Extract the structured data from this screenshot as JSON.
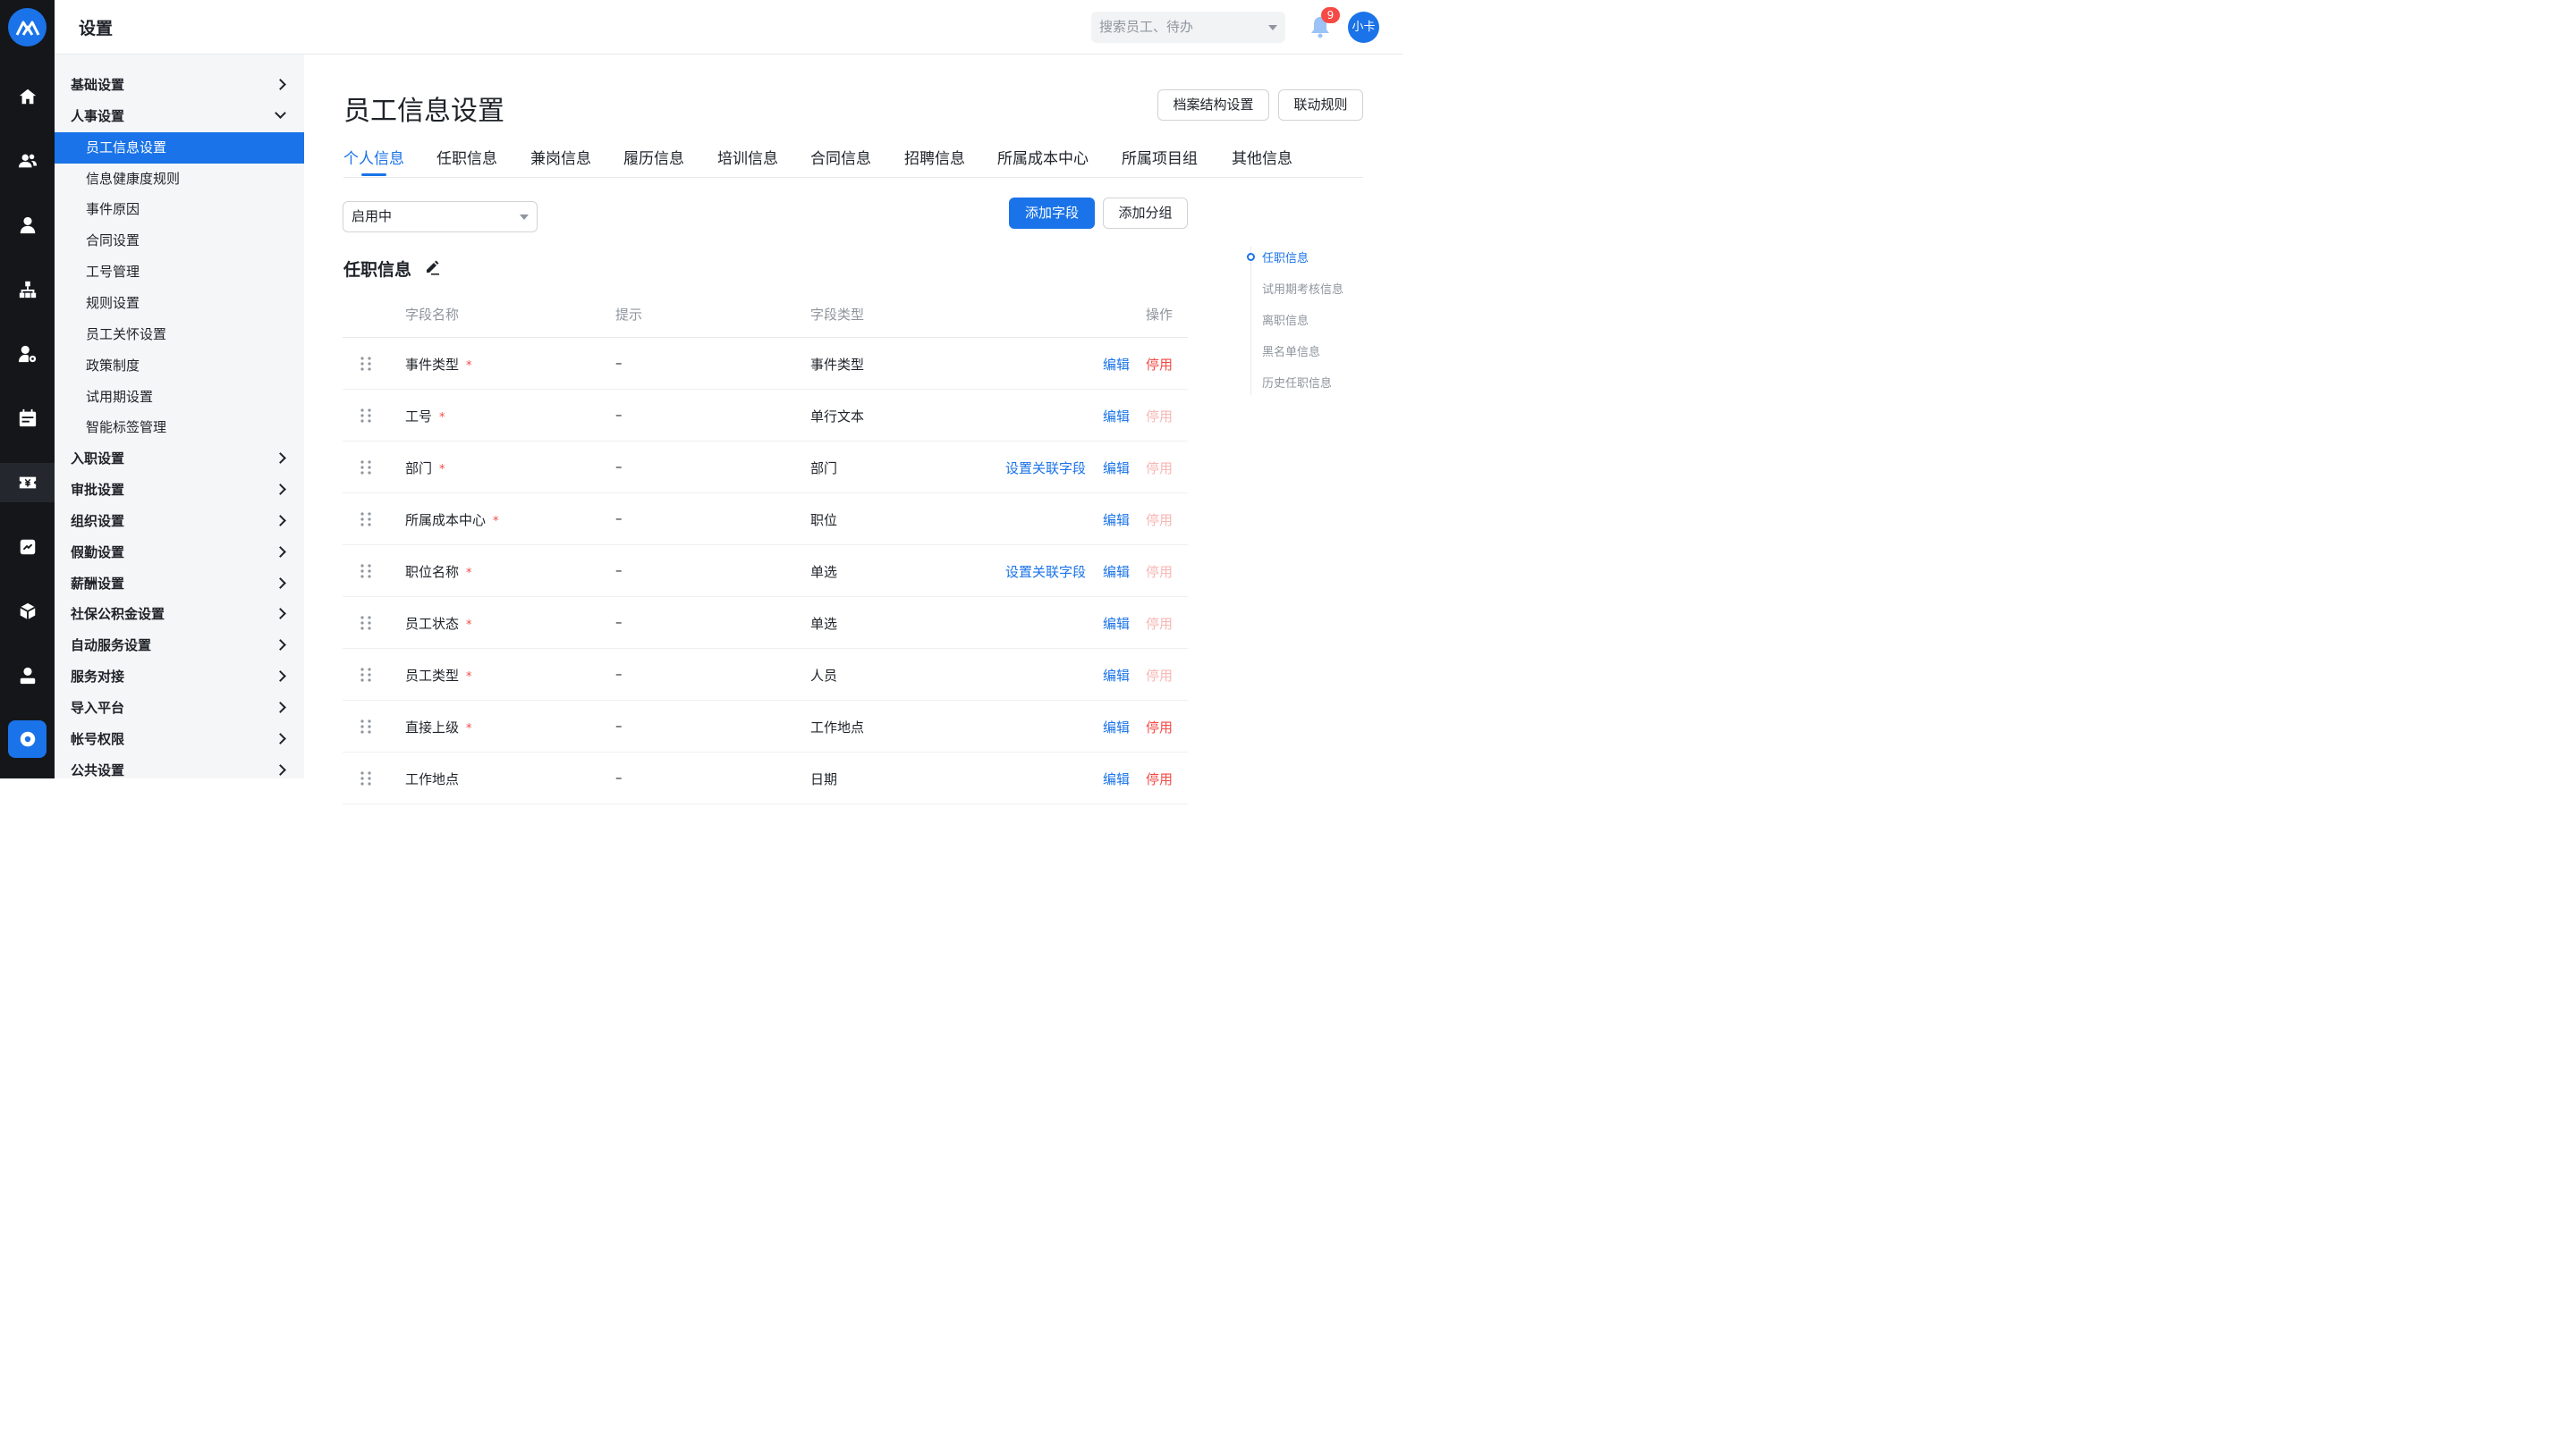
{
  "header": {
    "title": "设置",
    "search_placeholder": "搜索员工、待办",
    "notification_count": "9",
    "avatar_label": "小卡"
  },
  "rail": {
    "icons": [
      "home-icon",
      "people-icon",
      "person-icon",
      "org-chart-icon",
      "person-settings-icon",
      "calendar-icon",
      "payroll-icon",
      "report-icon",
      "box-icon",
      "user-icon",
      "settings-icon"
    ]
  },
  "sidebar": {
    "items": [
      {
        "label": "基础设置",
        "level": "top",
        "chevron": "right"
      },
      {
        "label": "人事设置",
        "level": "top",
        "chevron": "down"
      },
      {
        "label": "员工信息设置",
        "level": "sub",
        "active": true
      },
      {
        "label": "信息健康度规则",
        "level": "sub"
      },
      {
        "label": "事件原因",
        "level": "sub"
      },
      {
        "label": "合同设置",
        "level": "sub"
      },
      {
        "label": "工号管理",
        "level": "sub"
      },
      {
        "label": "规则设置",
        "level": "sub"
      },
      {
        "label": "员工关怀设置",
        "level": "sub"
      },
      {
        "label": "政策制度",
        "level": "sub"
      },
      {
        "label": "试用期设置",
        "level": "sub"
      },
      {
        "label": "智能标签管理",
        "level": "sub"
      },
      {
        "label": "入职设置",
        "level": "top",
        "chevron": "right"
      },
      {
        "label": "审批设置",
        "level": "top",
        "chevron": "right"
      },
      {
        "label": "组织设置",
        "level": "top",
        "chevron": "right"
      },
      {
        "label": "假勤设置",
        "level": "top",
        "chevron": "right"
      },
      {
        "label": "薪酬设置",
        "level": "top",
        "chevron": "right"
      },
      {
        "label": "社保公积金设置",
        "level": "top",
        "chevron": "right"
      },
      {
        "label": "自动服务设置",
        "level": "top",
        "chevron": "right"
      },
      {
        "label": "服务对接",
        "level": "top",
        "chevron": "right"
      },
      {
        "label": "导入平台",
        "level": "top",
        "chevron": "right"
      },
      {
        "label": "帐号权限",
        "level": "top",
        "chevron": "right"
      },
      {
        "label": "公共设置",
        "level": "top",
        "chevron": "right"
      }
    ]
  },
  "main": {
    "title": "员工信息设置",
    "btn_archive": "档案结构设置",
    "btn_linkage": "联动规则",
    "tabs": [
      "个人信息",
      "任职信息",
      "兼岗信息",
      "履历信息",
      "培训信息",
      "合同信息",
      "招聘信息",
      "所属成本中心",
      "所属项目组",
      "其他信息"
    ],
    "status_select": "启用中",
    "btn_add_field": "添加字段",
    "btn_add_group": "添加分组",
    "section_title": "任职信息",
    "columns": {
      "name": "字段名称",
      "hint": "提示",
      "type": "字段类型",
      "ops": "操作"
    },
    "rows": [
      {
        "name": "事件类型",
        "required": "*",
        "hint": "–",
        "type": "事件类型",
        "link": "",
        "edit": "编辑",
        "disable": "停用",
        "disable_enabled": true
      },
      {
        "name": "工号",
        "required": "*",
        "hint": "–",
        "type": "单行文本",
        "link": "",
        "edit": "编辑",
        "disable": "停用",
        "disable_enabled": false
      },
      {
        "name": "部门",
        "required": "*",
        "hint": "–",
        "type": "部门",
        "link": "设置关联字段",
        "edit": "编辑",
        "disable": "停用",
        "disable_enabled": false
      },
      {
        "name": "所属成本中心",
        "required": "*",
        "hint": "–",
        "type": "职位",
        "link": "",
        "edit": "编辑",
        "disable": "停用",
        "disable_enabled": false
      },
      {
        "name": "职位名称",
        "required": "*",
        "hint": "–",
        "type": "单选",
        "link": "设置关联字段",
        "edit": "编辑",
        "disable": "停用",
        "disable_enabled": false
      },
      {
        "name": "员工状态",
        "required": "*",
        "hint": "–",
        "type": "单选",
        "link": "",
        "edit": "编辑",
        "disable": "停用",
        "disable_enabled": false
      },
      {
        "name": "员工类型",
        "required": "*",
        "hint": "–",
        "type": "人员",
        "link": "",
        "edit": "编辑",
        "disable": "停用",
        "disable_enabled": false
      },
      {
        "name": "直接上级",
        "required": "*",
        "hint": "–",
        "type": "工作地点",
        "link": "",
        "edit": "编辑",
        "disable": "停用",
        "disable_enabled": true
      },
      {
        "name": "工作地点",
        "required": "",
        "hint": "–",
        "type": "日期",
        "link": "",
        "edit": "编辑",
        "disable": "停用",
        "disable_enabled": true
      }
    ],
    "anchors": [
      "任职信息",
      "试用期考核信息",
      "离职信息",
      "黑名单信息",
      "历史任职信息"
    ]
  },
  "colors": {
    "accent": "#1a73e8",
    "danger": "#f54a45",
    "rail_bg": "#14161a",
    "sidebar_bg": "#f5f6f7"
  }
}
